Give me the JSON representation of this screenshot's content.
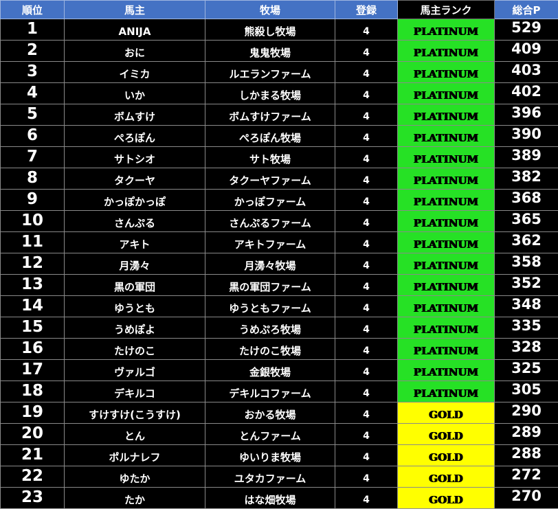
{
  "header": {
    "rank": "順位",
    "owner": "馬主",
    "ranch": "牧場",
    "registered": "登録",
    "grade": "馬主ランク",
    "points": "総合P"
  },
  "colors": {
    "header_bg": "#4472c4",
    "row_bg": "#000000",
    "platinum": "#26e125",
    "gold": "#ffff00"
  },
  "rows": [
    {
      "rank": "1",
      "owner": "ANIJA",
      "ranch": "熊殺し牧場",
      "registered": "4",
      "grade": "PLATINUM",
      "points": "529"
    },
    {
      "rank": "2",
      "owner": "おに",
      "ranch": "鬼鬼牧場",
      "registered": "4",
      "grade": "PLATINUM",
      "points": "409"
    },
    {
      "rank": "3",
      "owner": "イミカ",
      "ranch": "ルエランファーム",
      "registered": "4",
      "grade": "PLATINUM",
      "points": "403"
    },
    {
      "rank": "4",
      "owner": "いか",
      "ranch": "しかまる牧場",
      "registered": "4",
      "grade": "PLATINUM",
      "points": "402"
    },
    {
      "rank": "5",
      "owner": "ボムすけ",
      "ranch": "ボムすけファーム",
      "registered": "4",
      "grade": "PLATINUM",
      "points": "396"
    },
    {
      "rank": "6",
      "owner": "ぺろぽん",
      "ranch": "ぺろぽん牧場",
      "registered": "4",
      "grade": "PLATINUM",
      "points": "390"
    },
    {
      "rank": "7",
      "owner": "サトシオ",
      "ranch": "サト牧場",
      "registered": "4",
      "grade": "PLATINUM",
      "points": "389"
    },
    {
      "rank": "8",
      "owner": "タクーヤ",
      "ranch": "タクーヤファーム",
      "registered": "4",
      "grade": "PLATINUM",
      "points": "382"
    },
    {
      "rank": "9",
      "owner": "かっぽかっぽ",
      "ranch": "かっぽファーム",
      "registered": "4",
      "grade": "PLATINUM",
      "points": "368"
    },
    {
      "rank": "10",
      "owner": "さんぷる",
      "ranch": "さんぷるファーム",
      "registered": "4",
      "grade": "PLATINUM",
      "points": "365"
    },
    {
      "rank": "11",
      "owner": "アキト",
      "ranch": "アキトファーム",
      "registered": "4",
      "grade": "PLATINUM",
      "points": "362"
    },
    {
      "rank": "12",
      "owner": "月澷々",
      "ranch": "月澷々牧場",
      "registered": "4",
      "grade": "PLATINUM",
      "points": "358"
    },
    {
      "rank": "13",
      "owner": "黒の軍団",
      "ranch": "黒の軍団ファーム",
      "registered": "4",
      "grade": "PLATINUM",
      "points": "352"
    },
    {
      "rank": "14",
      "owner": "ゆうとも",
      "ranch": "ゆうともファーム",
      "registered": "4",
      "grade": "PLATINUM",
      "points": "348"
    },
    {
      "rank": "15",
      "owner": "うめぽよ",
      "ranch": "うめぷろ牧場",
      "registered": "4",
      "grade": "PLATINUM",
      "points": "335"
    },
    {
      "rank": "16",
      "owner": "たけのこ",
      "ranch": "たけのこ牧場",
      "registered": "4",
      "grade": "PLATINUM",
      "points": "328"
    },
    {
      "rank": "17",
      "owner": "ヴァルゴ",
      "ranch": "金銀牧場",
      "registered": "4",
      "grade": "PLATINUM",
      "points": "325"
    },
    {
      "rank": "18",
      "owner": "デキルコ",
      "ranch": "デキルコファーム",
      "registered": "4",
      "grade": "PLATINUM",
      "points": "305"
    },
    {
      "rank": "19",
      "owner": "すけすけ(こうすけ)",
      "ranch": "おかる牧場",
      "registered": "4",
      "grade": "GOLD",
      "points": "290"
    },
    {
      "rank": "20",
      "owner": "とん",
      "ranch": "とんファーム",
      "registered": "4",
      "grade": "GOLD",
      "points": "289"
    },
    {
      "rank": "21",
      "owner": "ポルナレフ",
      "ranch": "ゆいりま牧場",
      "registered": "4",
      "grade": "GOLD",
      "points": "288"
    },
    {
      "rank": "22",
      "owner": "ゆたか",
      "ranch": "ユタカファーム",
      "registered": "4",
      "grade": "GOLD",
      "points": "272"
    },
    {
      "rank": "23",
      "owner": "たか",
      "ranch": "はな畑牧場",
      "registered": "4",
      "grade": "GOLD",
      "points": "270"
    }
  ]
}
